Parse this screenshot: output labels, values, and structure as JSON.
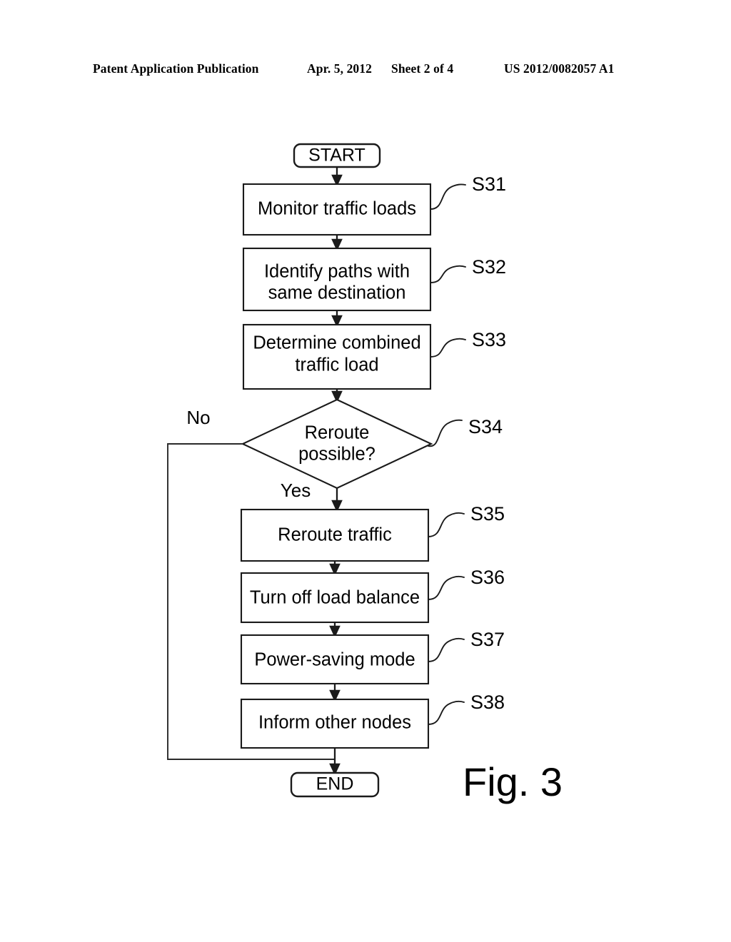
{
  "header": {
    "publication": "Patent Application Publication",
    "date": "Apr. 5, 2012",
    "sheet": "Sheet 2 of 4",
    "patent_number": "US 2012/0082057 A1"
  },
  "figure": {
    "caption": "Fig. 3",
    "terminals": {
      "start": "START",
      "end": "END"
    },
    "branches": {
      "no": "No",
      "yes": "Yes"
    },
    "steps": [
      {
        "id": "S31",
        "text": "Monitor traffic loads",
        "lines": [
          "Monitor traffic loads"
        ]
      },
      {
        "id": "S32",
        "text": "Identify paths with same destination",
        "lines": [
          "Identify paths with",
          "same destination"
        ]
      },
      {
        "id": "S33",
        "text": "Determine combined traffic load",
        "lines": [
          "Determine combined",
          "traffic load"
        ]
      },
      {
        "id": "S34",
        "text": "Reroute possible?",
        "lines": [
          "Reroute",
          "possible?"
        ]
      },
      {
        "id": "S35",
        "text": "Reroute traffic",
        "lines": [
          "Reroute traffic"
        ]
      },
      {
        "id": "S36",
        "text": "Turn off load balance",
        "lines": [
          "Turn off load balance"
        ]
      },
      {
        "id": "S37",
        "text": "Power-saving mode",
        "lines": [
          "Power-saving mode"
        ]
      },
      {
        "id": "S38",
        "text": "Inform other nodes",
        "lines": [
          "Inform other nodes"
        ]
      }
    ]
  },
  "colors": {
    "ink": "#1a1a1a",
    "paper": "#ffffff"
  }
}
